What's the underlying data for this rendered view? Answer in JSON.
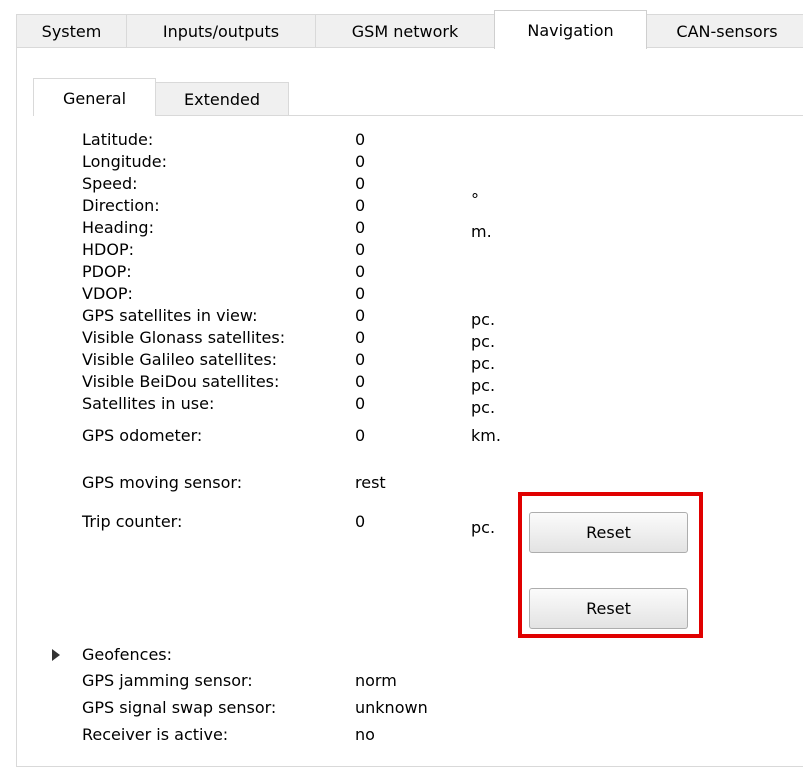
{
  "main_tabs": [
    {
      "label": "System"
    },
    {
      "label": "Inputs/outputs"
    },
    {
      "label": "GSM network"
    },
    {
      "label": "Navigation"
    },
    {
      "label": "CAN-sensors"
    }
  ],
  "active_main_tab": "Navigation",
  "sub_tabs": [
    {
      "label": "General"
    },
    {
      "label": "Extended"
    }
  ],
  "active_sub_tab": "General",
  "rows": [
    {
      "label": "Latitude:",
      "value": "0",
      "unit": ""
    },
    {
      "label": "Longitude:",
      "value": "0",
      "unit": ""
    },
    {
      "label": "Speed:",
      "value": "0",
      "unit": ""
    },
    {
      "label": "Direction:",
      "value": "0",
      "unit": "°"
    },
    {
      "label": "Heading:",
      "value": "0",
      "unit": "m."
    },
    {
      "label": "HDOP:",
      "value": "0",
      "unit": ""
    },
    {
      "label": "PDOP:",
      "value": "0",
      "unit": ""
    },
    {
      "label": "VDOP:",
      "value": "0",
      "unit": ""
    },
    {
      "label": "GPS satellites in view:",
      "value": "0",
      "unit": "pc."
    },
    {
      "label": "Visible Glonass satellites:",
      "value": "0",
      "unit": "pc."
    },
    {
      "label": "Visible Galileo satellites:",
      "value": "0",
      "unit": "pc."
    },
    {
      "label": "Visible BeiDou satellites:",
      "value": "0",
      "unit": "pc."
    },
    {
      "label": "Satellites in use:",
      "value": "0",
      "unit": "pc."
    },
    {
      "label": "GPS odometer:",
      "value": "0",
      "unit": "km."
    },
    {
      "label": "GPS moving sensor:",
      "value": "rest",
      "unit": ""
    },
    {
      "label": "Trip counter:",
      "value": "0",
      "unit": "pc."
    },
    {
      "label": "Geofences:",
      "value": "",
      "unit": ""
    },
    {
      "label": "GPS jamming sensor:",
      "value": "norm",
      "unit": ""
    },
    {
      "label": "GPS signal swap sensor:",
      "value": "unknown",
      "unit": ""
    },
    {
      "label": "Receiver is active:",
      "value": "no",
      "unit": ""
    }
  ],
  "buttons": {
    "odometer_reset": "Reset",
    "trip_counter_reset": "Reset"
  },
  "highlight_color": "#e00000"
}
